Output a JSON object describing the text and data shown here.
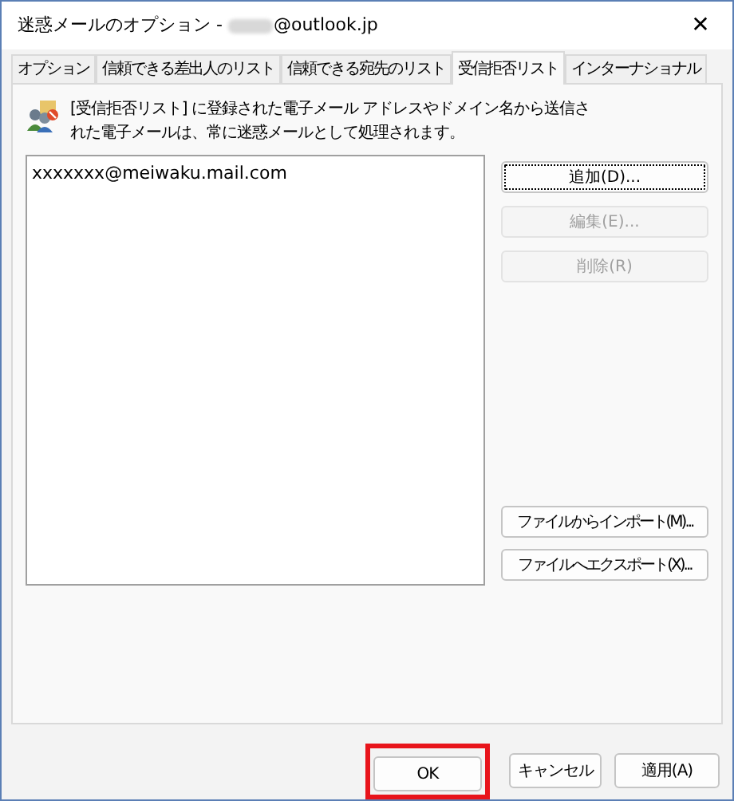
{
  "window": {
    "title": "迷惑メールのオプション -",
    "account": "@outlook.jp",
    "close": "✕"
  },
  "tabs": [
    {
      "label": "オプション",
      "selected": false
    },
    {
      "label": "信頼できる差出人のリスト",
      "selected": false
    },
    {
      "label": "信頼できる宛先のリスト",
      "selected": false
    },
    {
      "label": "受信拒否リスト",
      "selected": true
    },
    {
      "label": "インターナショナル",
      "selected": false
    }
  ],
  "description": "[受信拒否リスト] に登録された電子メール アドレスやドメイン名から送信された電子メールは、常に迷惑メールとして処理されます。",
  "list": {
    "items": [
      {
        "label": "xxxxxxx@meiwaku.mail.com",
        "selected": false
      }
    ]
  },
  "side_buttons": [
    {
      "label": "追加(D)...",
      "disabled": false,
      "focused": true
    },
    {
      "label": "編集(E)...",
      "disabled": true,
      "focused": false
    },
    {
      "label": "削除(R)",
      "disabled": true,
      "focused": false
    }
  ],
  "file_buttons": [
    {
      "label": "ファイルからインポート(M)..."
    },
    {
      "label": "ファイルへエクスポート(X)..."
    }
  ],
  "footer_buttons": [
    {
      "label": "OK",
      "highlighted": true
    },
    {
      "label": "キャンセル",
      "highlighted": false
    },
    {
      "label": "適用(A)",
      "highlighted": false
    }
  ]
}
